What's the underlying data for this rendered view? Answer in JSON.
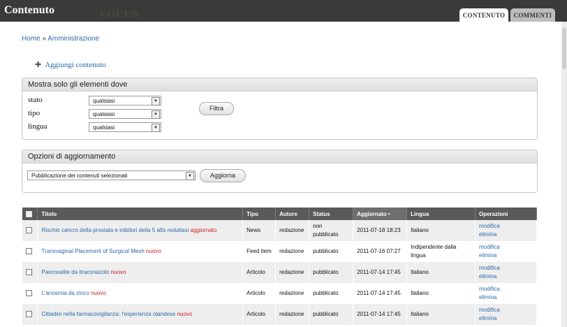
{
  "header": {
    "title": "Contenuto",
    "ghost_logo": "FOCUS",
    "tabs": [
      {
        "label": "CONTENUTO",
        "active": true
      },
      {
        "label": "COMMENTI",
        "active": false
      }
    ]
  },
  "breadcrumb": {
    "home": "Home",
    "sep": "»",
    "admin": "Amministrazione"
  },
  "actions": {
    "add_content": "Aggiungi contenuto",
    "add_icon": "plus-icon"
  },
  "filter": {
    "legend": "Mostra solo gli elementi dove",
    "rows": [
      {
        "label": "stato",
        "value": "qualsiasi"
      },
      {
        "label": "tipo",
        "value": "qualsiasi"
      },
      {
        "label": "lingua",
        "value": "qualsiasi"
      }
    ],
    "button": "Filtra"
  },
  "update": {
    "legend": "Opzioni di aggiornamento",
    "value": "Pubblicazione dei contenuti selezionati",
    "button": "Aggiorna"
  },
  "table": {
    "headers": [
      "Titolo",
      "Tipo",
      "Autore",
      "Status",
      "Aggiornato",
      "Lingua",
      "Operazioni"
    ],
    "sorted_column": "Aggiornato",
    "rows": [
      {
        "title": "Rischio cancro della prostata e inibitori della 5 alfa reduttasi",
        "flag": "aggiornato",
        "type": "News",
        "author": "redazione",
        "status": "non pubblicato",
        "updated": "2011-07-18 18:23",
        "language": "Italiano",
        "edit": "modifica",
        "delete": "elimina"
      },
      {
        "title": "Transvaginal Placement of Surgical Mesh",
        "flag": "nuovo",
        "type": "Feed item",
        "author": "redazione",
        "status": "pubblicato",
        "updated": "2011-07-16 07:27",
        "language": "Indipendente dalla lingua",
        "edit": "modifica",
        "delete": "elimina"
      },
      {
        "title": "Pancreatite da itraconazolo",
        "flag": "nuovo",
        "type": "Articolo",
        "author": "redazione",
        "status": "pubblicato",
        "updated": "2011-07-14 17:45",
        "language": "Italiano",
        "edit": "modifica",
        "delete": "elimina"
      },
      {
        "title": "L'anosmia da zinco",
        "flag": "nuovo",
        "type": "Articolo",
        "author": "redazione",
        "status": "pubblicato",
        "updated": "2011-07-14 17:45",
        "language": "Italiano",
        "edit": "modifica",
        "delete": "elimina"
      },
      {
        "title": "Cittadini nella farmacovigilanza: l'esperienza olandese",
        "flag": "nuovo",
        "type": "Articolo",
        "author": "redazione",
        "status": "pubblicato",
        "updated": "2011-07-14 17:45",
        "language": "Italiano",
        "edit": "modifica",
        "delete": "elimina"
      }
    ]
  },
  "colors": {
    "topbar": "#3a3a3a",
    "link": "#2a6aa8",
    "flag": "#cc2222",
    "table_header": "#5a5a5a"
  }
}
